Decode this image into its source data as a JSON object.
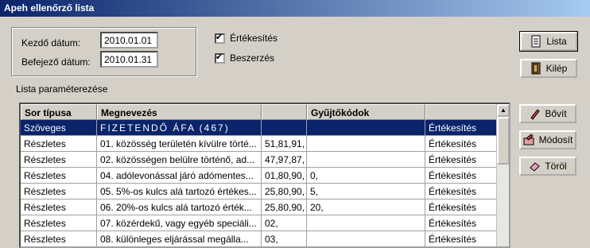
{
  "window": {
    "title": "Apeh ellenőrző lista"
  },
  "dates": {
    "start_label": "Kezdő dátum:",
    "start_value": "2010.01.01",
    "end_label": "Befejező dátum:",
    "end_value": "2010.01.31"
  },
  "filters": {
    "sales_label": "Értékesítés",
    "sales_checked": true,
    "purchase_label": "Beszerzés",
    "purchase_checked": true
  },
  "buttons": {
    "list": "Lista",
    "exit": "Kilép",
    "expand": "Bővít",
    "modify": "Módosít",
    "delete": "Töröl"
  },
  "section_label": "Lista paraméterezése",
  "table": {
    "columns": [
      "Sor típusa",
      "Megnevezés",
      "",
      "Gyűjtőkódok",
      ""
    ],
    "rows": [
      [
        "Szöveges",
        "FIZETENDŐ ÁFA (467)",
        "",
        "",
        "Értékesítés"
      ],
      [
        "Részletes",
        "01. közösség területén kívülre törté...",
        "51,81,91,",
        "",
        "Értékesítés"
      ],
      [
        "Részletes",
        "02. közösségen belülre történő, ad...",
        "47,97,87,",
        "",
        "Értékesítés"
      ],
      [
        "Részletes",
        "04. adólevonással járó adómentes...",
        "01,80,90,",
        "0,",
        "Értékesítés"
      ],
      [
        "Részletes",
        "05. 5%-os kulcs alá tartozó értékes...",
        "25,80,90,",
        "5,",
        "Értékesítés"
      ],
      [
        "Részletes",
        "06. 20%-os kulcs alá tartozó érték...",
        "25,80,90,",
        "20,",
        "Értékesítés"
      ],
      [
        "Részletes",
        "07. közérdekű, vagy egyéb speciáli...",
        "02,",
        "",
        "Értékesítés"
      ],
      [
        "Részletes",
        "08. különleges eljárással megálla...",
        "03,",
        "",
        "Értékesítés"
      ]
    ]
  }
}
